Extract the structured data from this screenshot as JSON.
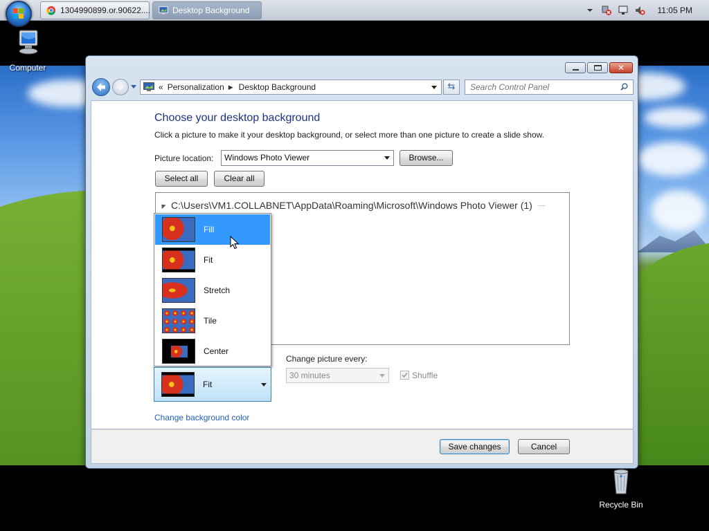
{
  "taskbar": {
    "tasks": [
      {
        "label": "1304990899.or.90622....",
        "icon": "chrome-icon",
        "active": false
      },
      {
        "label": "Desktop Background",
        "icon": "control-panel-icon",
        "active": true
      }
    ],
    "tray_icons": [
      "chevron-up-icon",
      "network-error-icon",
      "monitor-icon",
      "volume-muted-icon"
    ],
    "clock": "11:05 PM"
  },
  "desktop": {
    "icons": [
      {
        "label": "Computer",
        "icon": "computer-icon"
      },
      {
        "label": "Recycle Bin",
        "icon": "recycle-bin-icon"
      }
    ]
  },
  "window": {
    "breadcrumb": [
      "Personalization",
      "Desktop Background"
    ],
    "breadcrumb_prefix": "«",
    "search_placeholder": "Search Control Panel",
    "title": "Choose your desktop background",
    "subtitle": "Click a picture to make it your desktop background, or select more than one picture to create a slide show.",
    "picture_location_label": "Picture location:",
    "picture_location_value": "Windows Photo Viewer",
    "browse_label": "Browse...",
    "select_all_label": "Select all",
    "clear_all_label": "Clear all",
    "folder_path": "C:\\Users\\VM1.COLLABNET\\AppData\\Roaming\\Microsoft\\Windows Photo Viewer (1)",
    "picture_position": {
      "options": [
        "Fill",
        "Fit",
        "Stretch",
        "Tile",
        "Center"
      ],
      "highlighted": "Fill",
      "selected": "Fit"
    },
    "change_picture_label": "Change picture every:",
    "change_picture_value": "30 minutes",
    "shuffle_label": "Shuffle",
    "change_bg_color_link": "Change background color",
    "save_label": "Save changes",
    "cancel_label": "Cancel"
  },
  "colors": {
    "accent": "#3399ff",
    "title_text": "#1e3287",
    "link": "#1f5fb8"
  }
}
